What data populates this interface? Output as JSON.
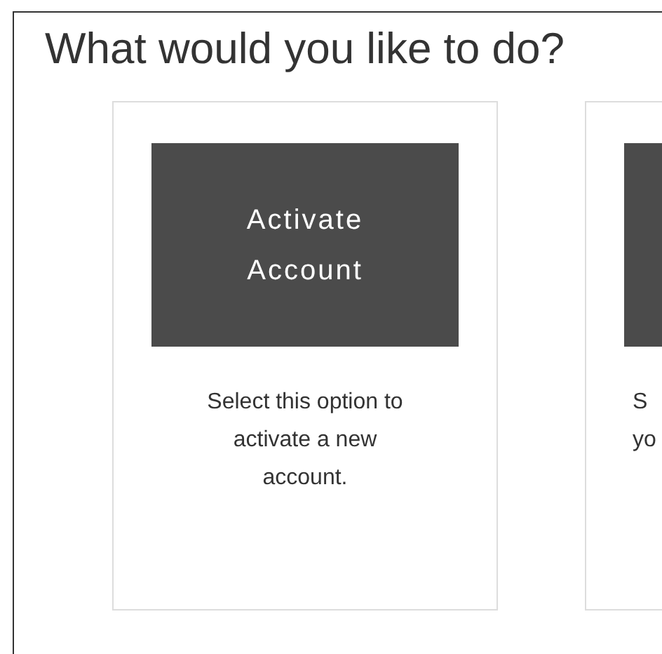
{
  "heading": "What would you like to do?",
  "options": [
    {
      "title": "Activate\nAccount",
      "description": "Select this option to activate a new account."
    },
    {
      "description": "S\nyo"
    }
  ]
}
